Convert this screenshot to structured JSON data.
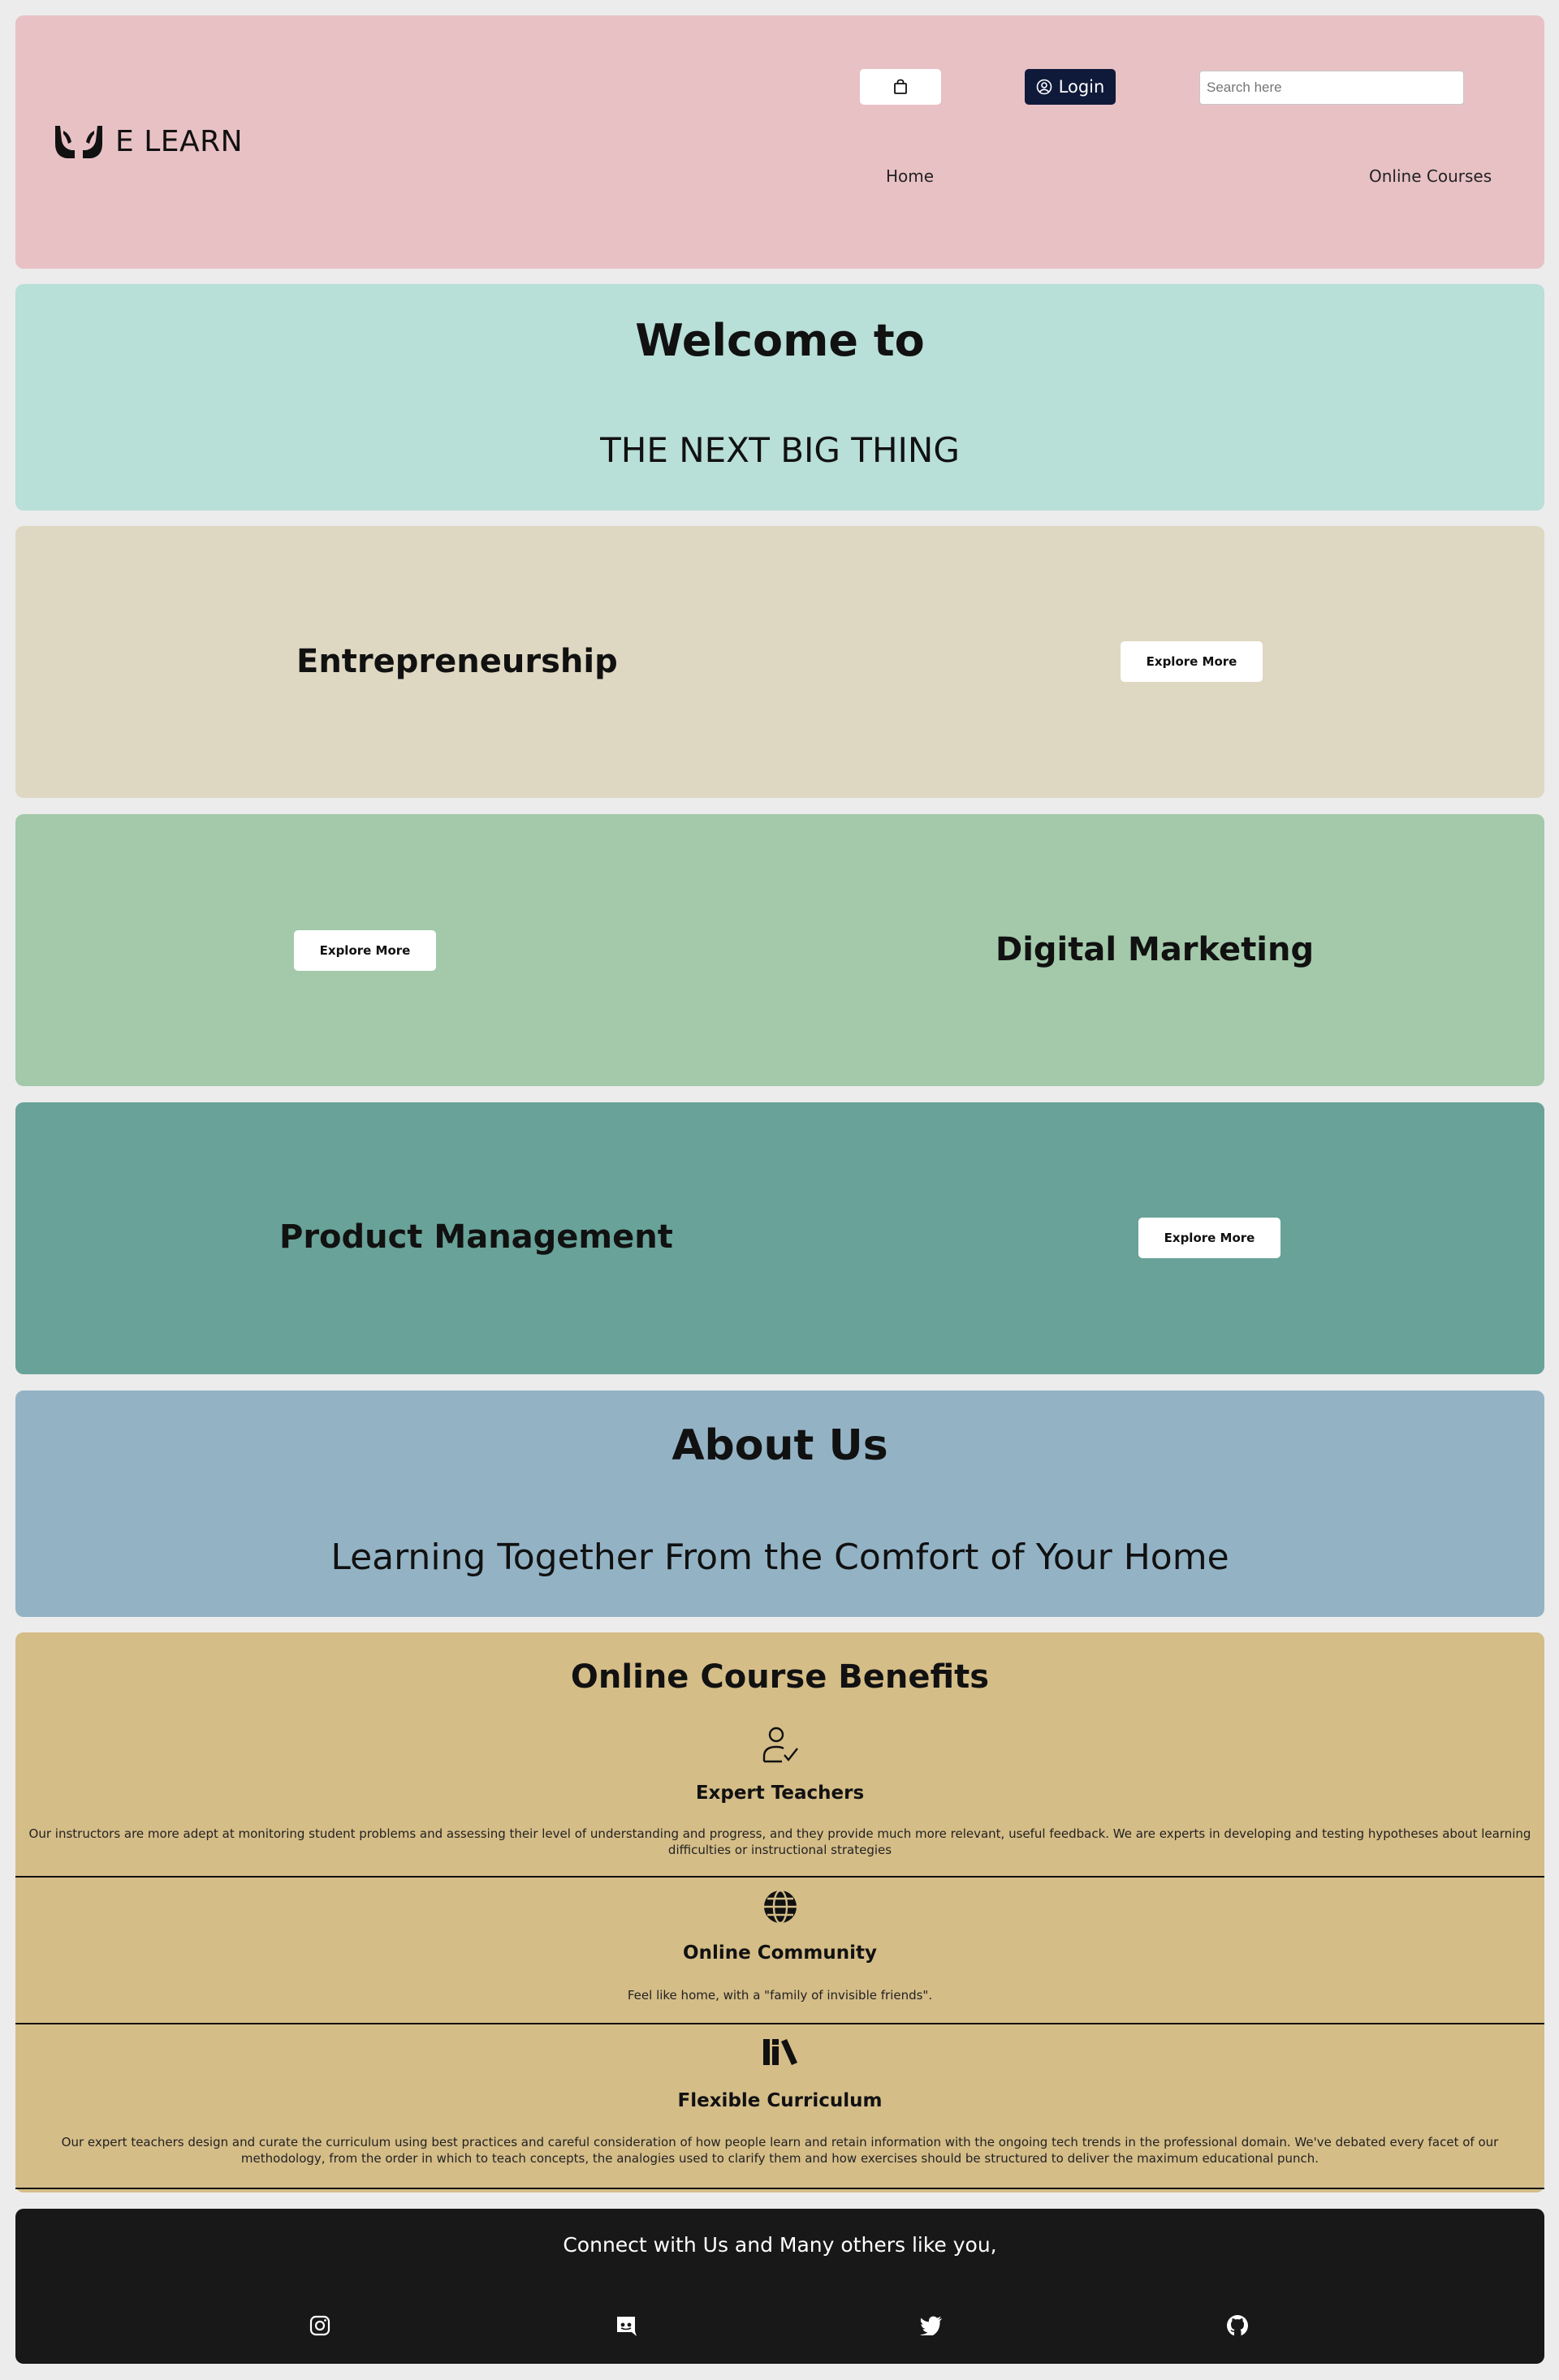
{
  "header": {
    "logo_text": "E LEARN",
    "cart_icon": "shopping-bag-icon",
    "login_label": "Login",
    "search_placeholder": "Search here",
    "nav": {
      "home": "Home",
      "courses": "Online Courses"
    }
  },
  "welcome": {
    "title": "Welcome to",
    "subtitle": "THE NEXT BIG THING"
  },
  "courses": [
    {
      "title": "Entrepreneurship",
      "button": "Explore More",
      "color": "#ded7c2"
    },
    {
      "title": "Digital Marketing",
      "button": "Explore More",
      "color": "#a3c9aa"
    },
    {
      "title": "Product Management",
      "button": "Explore More",
      "color": "#69a298"
    }
  ],
  "about": {
    "title": "About Us",
    "subtitle": "Learning Together From the Comfort of Your Home"
  },
  "benefits": {
    "title": "Online Course Benefits",
    "items": [
      {
        "icon": "teacher-check-icon",
        "title": "Expert Teachers",
        "text": "Our instructors are more adept at monitoring student problems and assessing their level of understanding and progress, and they provide much more relevant, useful feedback. We are experts in developing and testing hypotheses about learning difficulties or instructional strategies"
      },
      {
        "icon": "globe-icon",
        "title": "Online Community",
        "text": "Feel like home, with a \"family of invisible friends\"."
      },
      {
        "icon": "books-icon",
        "title": "Flexible Curriculum",
        "text": "Our expert teachers design and curate the curriculum using best practices and careful consideration of how people learn and retain information with the ongoing tech trends in the professional domain. We've debated every facet of our methodology, from the order in which to teach concepts, the analogies used to clarify them and how exercises should be structured to deliver the maximum educational punch."
      }
    ]
  },
  "footer": {
    "text": "Connect with Us and Many others like you,",
    "social": [
      "instagram-icon",
      "discord-icon",
      "twitter-icon",
      "github-icon"
    ]
  }
}
